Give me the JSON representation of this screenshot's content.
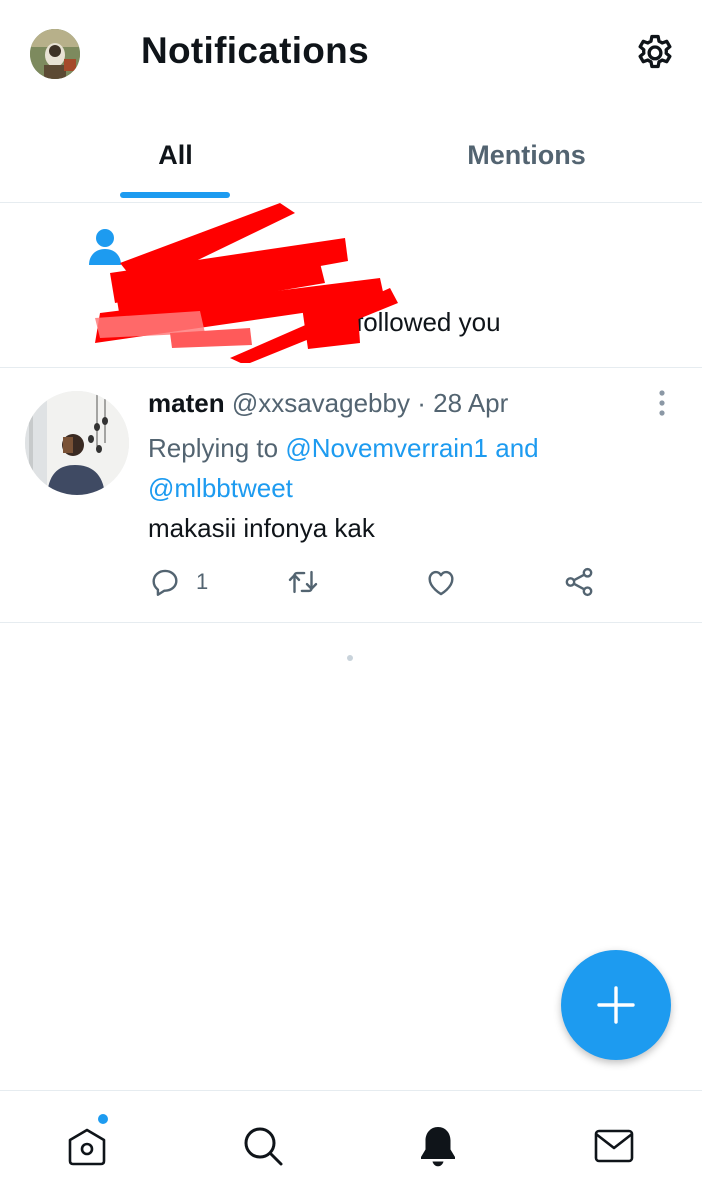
{
  "header": {
    "title": "Notifications",
    "settings_icon": "gear-icon"
  },
  "tabs": [
    {
      "label": "All",
      "active": true
    },
    {
      "label": "Mentions",
      "active": false
    }
  ],
  "follow_notification": {
    "icon": "person-icon",
    "text": "followed you"
  },
  "tweet": {
    "name": "maten",
    "handle": "@xxsavagebby",
    "separator": "·",
    "date": "28 Apr",
    "replying_prefix": "Replying to",
    "reply_to_1": "@Novemverrain1",
    "reply_and": "and",
    "reply_to_2": "@mlbbtweet",
    "body": "makasii infonya kak",
    "reply_count": "1"
  },
  "colors": {
    "accent": "#1d9bf0",
    "text": "#0f1419",
    "muted": "#536471",
    "divider": "#e6ecf0"
  },
  "bottom_nav": [
    "home-icon",
    "search-icon",
    "bell-icon",
    "mail-icon"
  ]
}
